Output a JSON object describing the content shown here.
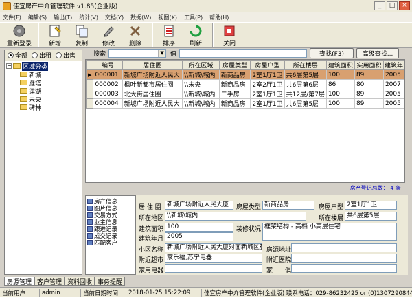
{
  "window": {
    "title": "佳宜房产中介管理软件 v1.85(企业版)"
  },
  "menu": [
    "文件(F)",
    "编辑(S)",
    "输出(T)",
    "统计(V)",
    "文档(Y)",
    "数据(W)",
    "视图(X)",
    "工具(P)",
    "帮助(H)"
  ],
  "toolbar": [
    {
      "label": "重新登录",
      "icon": "relogin-icon"
    },
    {
      "label": "新增",
      "icon": "add-icon"
    },
    {
      "label": "复制",
      "icon": "copy-icon"
    },
    {
      "label": "修改",
      "icon": "edit-icon"
    },
    {
      "label": "删除",
      "icon": "delete-icon"
    },
    {
      "label": "排序",
      "icon": "sort-icon"
    },
    {
      "label": "刷新",
      "icon": "refresh-icon"
    },
    {
      "label": "关闭",
      "icon": "close-icon"
    }
  ],
  "filter": {
    "all": "全部",
    "rent": "出租",
    "sale": "出售"
  },
  "tree": {
    "root": "区域分类",
    "children": [
      "新城",
      "雁塔",
      "莲湖",
      "未央",
      "碑林"
    ]
  },
  "search": {
    "field_label": "搜索",
    "value_label": "值",
    "find_button": "查找(F3)",
    "advanced_button": "高级查找..."
  },
  "grid": {
    "columns": [
      "编号",
      "居住圈",
      "所在区域",
      "房屋类型",
      "房屋户型",
      "所在楼层",
      "建筑面积",
      "实用面积",
      "建筑年"
    ],
    "rows": [
      [
        "000001",
        "新城广场附近人民大",
        "\\\\新城\\城内",
        "新商品房",
        "2室1厅1卫",
        "共6层第5层",
        "100",
        "89",
        "2005"
      ],
      [
        "000002",
        "枫叶新都市居住圈",
        "\\\\未央",
        "新商品房",
        "2室2厅1卫",
        "共6层第6层",
        "86",
        "80",
        "2007"
      ],
      [
        "000003",
        "北大街居住圈",
        "\\\\新城\\城内",
        "二手房",
        "2室1厅1卫",
        "共12层/第7层",
        "100",
        "89",
        "2005"
      ],
      [
        "000004",
        "新城广场附近人民大",
        "\\\\新城\\城内",
        "新商品房",
        "2室1厅1卫",
        "共6层第5层",
        "100",
        "89",
        "2005"
      ]
    ]
  },
  "record_count": "房产登记总数：  4  条",
  "nav": [
    "房产信息",
    "图片信息",
    "交易方式",
    "业主信息",
    "跟进记录",
    "成交记录",
    "匹配客户"
  ],
  "detail": {
    "circle_label": "居 住 圈",
    "circle_value": "新城广场附近人民大厦",
    "type_label": "房屋类型",
    "type_value": "新商品房",
    "layout_label": "房屋户型",
    "layout_value": "2室1厅1卫",
    "area_label": "所在地区",
    "area_value": "\\\\新城\\城内",
    "floor_label": "所在楼层",
    "floor_value": "共6层第5层",
    "build_area_label": "建筑面积",
    "build_area_value": "100",
    "decor_label": "装修状况",
    "decor_value": "框架结构 - 高档 小高层住宅",
    "year_label": "建筑年月",
    "year_value": "2005",
    "community_label": "小区名称",
    "community_value": "新城广场附近人民大厦对面新城区教育",
    "address_label": "房源地址",
    "address_value": "",
    "market_label": "附近超市",
    "market_value": "家乐福,苏宁电器",
    "hospital_label": "附近医院",
    "hospital_value": "",
    "appliance_label": "家用电器",
    "appliance_value": "",
    "furniture_label": "家　　俱",
    "furniture_value": ""
  },
  "bottom_tabs": [
    "房源管理",
    "客户管理",
    "资料回收",
    "事务提醒"
  ],
  "status": {
    "user_label": "当前用户",
    "user_value": "admin",
    "time_label": "当前日期时间",
    "time_value": "2018-01-25 15:22:09",
    "info": "佳宜房产中介管理软件(企业版) 联系电话：029-86232425 or (0)13072908445"
  },
  "colors": {
    "selected_row": "#d8a070",
    "tree_selection": "#0a246a",
    "count_text": "#0000c0"
  }
}
